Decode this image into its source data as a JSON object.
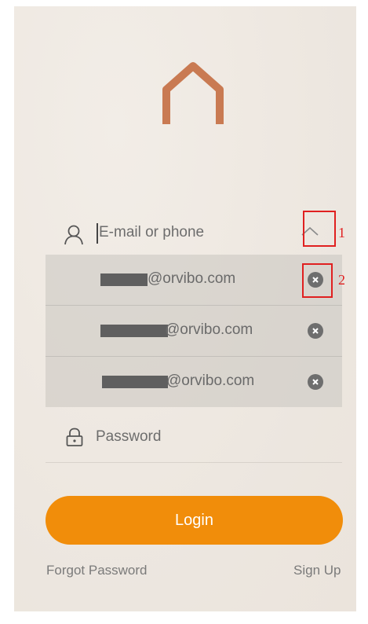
{
  "colors": {
    "accent": "#f18d0a",
    "logo": "#c97a52",
    "annotation": "#e02020"
  },
  "email": {
    "placeholder": "E-mail or phone",
    "icon": "user-icon",
    "toggle_icon": "chevron-up-icon"
  },
  "accounts": [
    {
      "domain": "@orvibo.com"
    },
    {
      "domain": "@orvibo.com"
    },
    {
      "domain": "@orvibo.com"
    }
  ],
  "password": {
    "placeholder": "Password",
    "icon": "lock-icon"
  },
  "login_label": "Login",
  "forgot_label": "Forgot Password",
  "signup_label": "Sign Up",
  "annotations": [
    "1",
    "2"
  ]
}
